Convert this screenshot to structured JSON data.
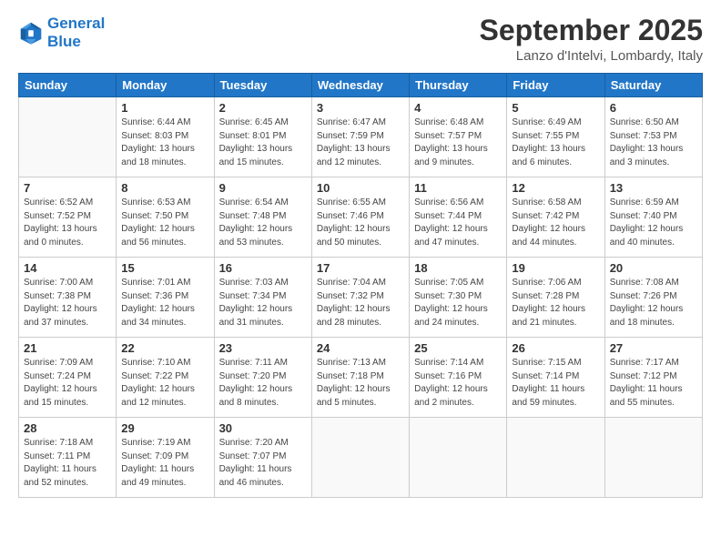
{
  "logo": {
    "line1": "General",
    "line2": "Blue"
  },
  "title": "September 2025",
  "subtitle": "Lanzo d'Intelvi, Lombardy, Italy",
  "weekdays": [
    "Sunday",
    "Monday",
    "Tuesday",
    "Wednesday",
    "Thursday",
    "Friday",
    "Saturday"
  ],
  "weeks": [
    [
      {
        "day": "",
        "info": ""
      },
      {
        "day": "1",
        "info": "Sunrise: 6:44 AM\nSunset: 8:03 PM\nDaylight: 13 hours\nand 18 minutes."
      },
      {
        "day": "2",
        "info": "Sunrise: 6:45 AM\nSunset: 8:01 PM\nDaylight: 13 hours\nand 15 minutes."
      },
      {
        "day": "3",
        "info": "Sunrise: 6:47 AM\nSunset: 7:59 PM\nDaylight: 13 hours\nand 12 minutes."
      },
      {
        "day": "4",
        "info": "Sunrise: 6:48 AM\nSunset: 7:57 PM\nDaylight: 13 hours\nand 9 minutes."
      },
      {
        "day": "5",
        "info": "Sunrise: 6:49 AM\nSunset: 7:55 PM\nDaylight: 13 hours\nand 6 minutes."
      },
      {
        "day": "6",
        "info": "Sunrise: 6:50 AM\nSunset: 7:53 PM\nDaylight: 13 hours\nand 3 minutes."
      }
    ],
    [
      {
        "day": "7",
        "info": "Sunrise: 6:52 AM\nSunset: 7:52 PM\nDaylight: 13 hours\nand 0 minutes."
      },
      {
        "day": "8",
        "info": "Sunrise: 6:53 AM\nSunset: 7:50 PM\nDaylight: 12 hours\nand 56 minutes."
      },
      {
        "day": "9",
        "info": "Sunrise: 6:54 AM\nSunset: 7:48 PM\nDaylight: 12 hours\nand 53 minutes."
      },
      {
        "day": "10",
        "info": "Sunrise: 6:55 AM\nSunset: 7:46 PM\nDaylight: 12 hours\nand 50 minutes."
      },
      {
        "day": "11",
        "info": "Sunrise: 6:56 AM\nSunset: 7:44 PM\nDaylight: 12 hours\nand 47 minutes."
      },
      {
        "day": "12",
        "info": "Sunrise: 6:58 AM\nSunset: 7:42 PM\nDaylight: 12 hours\nand 44 minutes."
      },
      {
        "day": "13",
        "info": "Sunrise: 6:59 AM\nSunset: 7:40 PM\nDaylight: 12 hours\nand 40 minutes."
      }
    ],
    [
      {
        "day": "14",
        "info": "Sunrise: 7:00 AM\nSunset: 7:38 PM\nDaylight: 12 hours\nand 37 minutes."
      },
      {
        "day": "15",
        "info": "Sunrise: 7:01 AM\nSunset: 7:36 PM\nDaylight: 12 hours\nand 34 minutes."
      },
      {
        "day": "16",
        "info": "Sunrise: 7:03 AM\nSunset: 7:34 PM\nDaylight: 12 hours\nand 31 minutes."
      },
      {
        "day": "17",
        "info": "Sunrise: 7:04 AM\nSunset: 7:32 PM\nDaylight: 12 hours\nand 28 minutes."
      },
      {
        "day": "18",
        "info": "Sunrise: 7:05 AM\nSunset: 7:30 PM\nDaylight: 12 hours\nand 24 minutes."
      },
      {
        "day": "19",
        "info": "Sunrise: 7:06 AM\nSunset: 7:28 PM\nDaylight: 12 hours\nand 21 minutes."
      },
      {
        "day": "20",
        "info": "Sunrise: 7:08 AM\nSunset: 7:26 PM\nDaylight: 12 hours\nand 18 minutes."
      }
    ],
    [
      {
        "day": "21",
        "info": "Sunrise: 7:09 AM\nSunset: 7:24 PM\nDaylight: 12 hours\nand 15 minutes."
      },
      {
        "day": "22",
        "info": "Sunrise: 7:10 AM\nSunset: 7:22 PM\nDaylight: 12 hours\nand 12 minutes."
      },
      {
        "day": "23",
        "info": "Sunrise: 7:11 AM\nSunset: 7:20 PM\nDaylight: 12 hours\nand 8 minutes."
      },
      {
        "day": "24",
        "info": "Sunrise: 7:13 AM\nSunset: 7:18 PM\nDaylight: 12 hours\nand 5 minutes."
      },
      {
        "day": "25",
        "info": "Sunrise: 7:14 AM\nSunset: 7:16 PM\nDaylight: 12 hours\nand 2 minutes."
      },
      {
        "day": "26",
        "info": "Sunrise: 7:15 AM\nSunset: 7:14 PM\nDaylight: 11 hours\nand 59 minutes."
      },
      {
        "day": "27",
        "info": "Sunrise: 7:17 AM\nSunset: 7:12 PM\nDaylight: 11 hours\nand 55 minutes."
      }
    ],
    [
      {
        "day": "28",
        "info": "Sunrise: 7:18 AM\nSunset: 7:11 PM\nDaylight: 11 hours\nand 52 minutes."
      },
      {
        "day": "29",
        "info": "Sunrise: 7:19 AM\nSunset: 7:09 PM\nDaylight: 11 hours\nand 49 minutes."
      },
      {
        "day": "30",
        "info": "Sunrise: 7:20 AM\nSunset: 7:07 PM\nDaylight: 11 hours\nand 46 minutes."
      },
      {
        "day": "",
        "info": ""
      },
      {
        "day": "",
        "info": ""
      },
      {
        "day": "",
        "info": ""
      },
      {
        "day": "",
        "info": ""
      }
    ]
  ]
}
